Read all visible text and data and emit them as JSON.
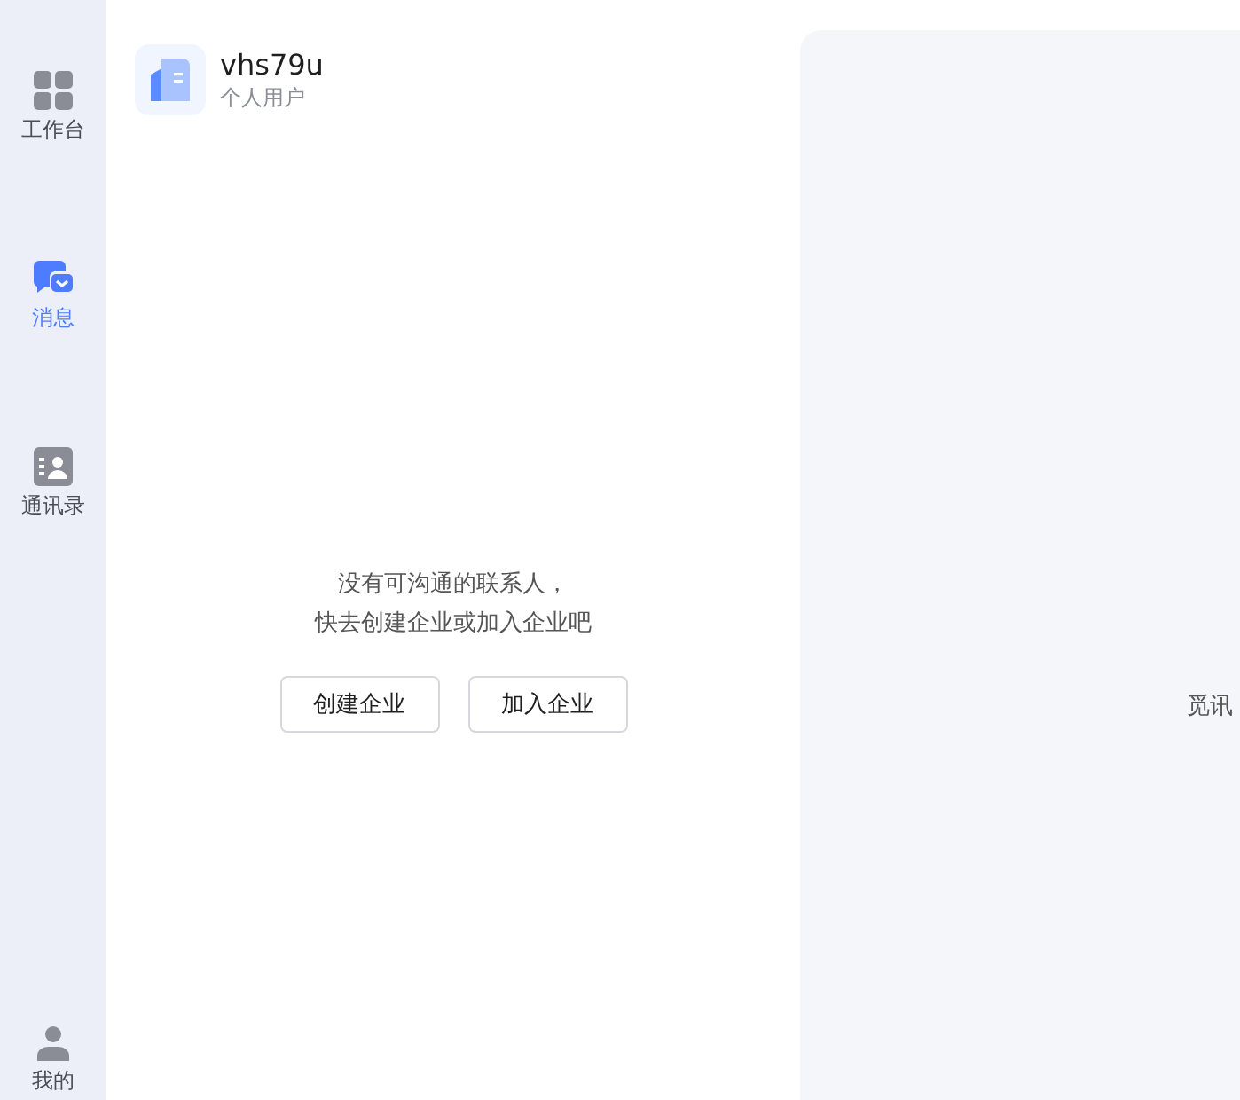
{
  "sidebar": {
    "items": [
      {
        "kind": "workbench",
        "label": "工作台",
        "selected": false
      },
      {
        "kind": "messages",
        "label": "消息",
        "selected": true
      },
      {
        "kind": "contacts",
        "label": "通讯录",
        "selected": false
      }
    ],
    "profile": {
      "label": "我的",
      "selected": false
    }
  },
  "account": {
    "name": "vhs79u",
    "type": "个人用户"
  },
  "empty_state": {
    "lines": [
      "没有可沟通的联系人，",
      "快去创建企业或加入企业吧"
    ],
    "buttons": [
      "创建企业",
      "加入企业"
    ]
  },
  "detail": {
    "text": "觅讯"
  }
}
